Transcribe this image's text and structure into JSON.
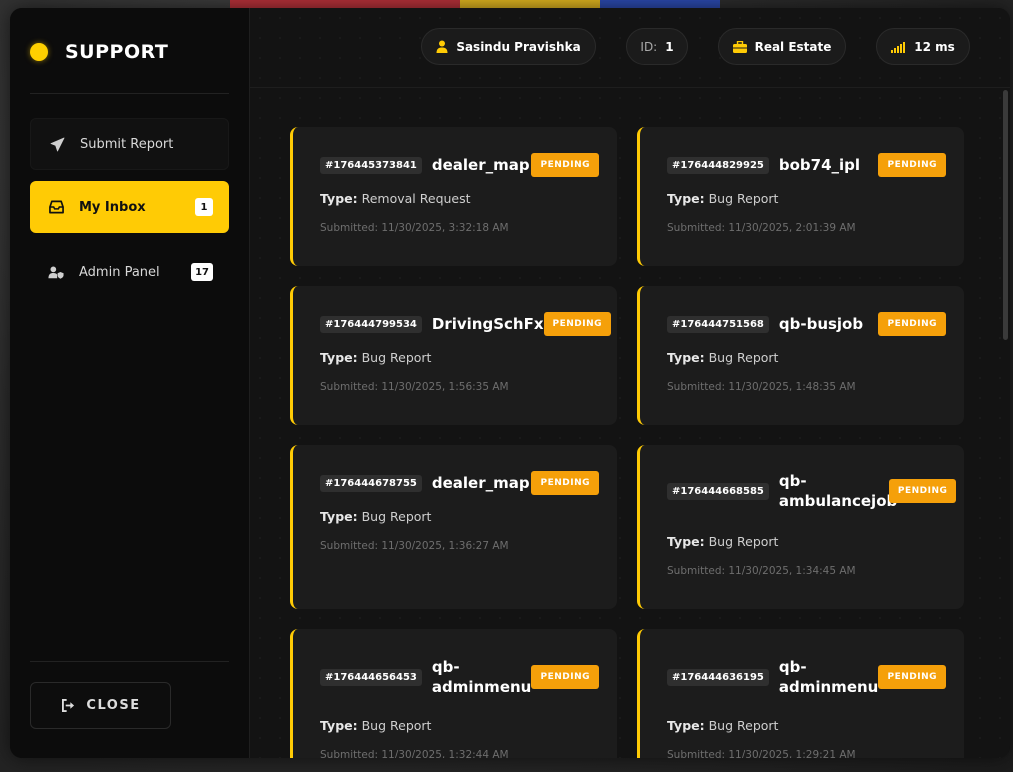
{
  "brand": {
    "title": "SUPPORT"
  },
  "nav": {
    "items": [
      {
        "label": "Submit Report",
        "icon": "paper-plane-icon",
        "badge": null,
        "state": "default"
      },
      {
        "label": "My Inbox",
        "icon": "inbox-icon",
        "badge": "1",
        "state": "active"
      },
      {
        "label": "Admin Panel",
        "icon": "user-shield-icon",
        "badge": "17",
        "state": "default"
      }
    ],
    "close_label": "CLOSE"
  },
  "header": {
    "user_name": "Sasindu Pravishka",
    "id_label": "ID:",
    "id_value": "1",
    "job": "Real Estate",
    "ping": "12 ms"
  },
  "colors": {
    "accent": "#ffcb05",
    "status_pending": "#f5a00a"
  },
  "type_label": "Type:",
  "reports": [
    {
      "id": "#176445373841",
      "name": "dealer_map",
      "status": "PENDING",
      "type": "Removal Request",
      "submitted": "Submitted: 11/30/2025, 3:32:18 AM"
    },
    {
      "id": "#176444829925",
      "name": "bob74_ipl",
      "status": "PENDING",
      "type": "Bug Report",
      "submitted": "Submitted: 11/30/2025, 2:01:39 AM"
    },
    {
      "id": "#176444799534",
      "name": "DrivingSchFx",
      "status": "PENDING",
      "type": "Bug Report",
      "submitted": "Submitted: 11/30/2025, 1:56:35 AM"
    },
    {
      "id": "#176444751568",
      "name": "qb-busjob",
      "status": "PENDING",
      "type": "Bug Report",
      "submitted": "Submitted: 11/30/2025, 1:48:35 AM"
    },
    {
      "id": "#176444678755",
      "name": "dealer_map",
      "status": "PENDING",
      "type": "Bug Report",
      "submitted": "Submitted: 11/30/2025, 1:36:27 AM"
    },
    {
      "id": "#176444668585",
      "name": "qb-ambulancejob",
      "status": "PENDING",
      "type": "Bug Report",
      "submitted": "Submitted: 11/30/2025, 1:34:45 AM"
    },
    {
      "id": "#176444656453",
      "name": "qb-adminmenu",
      "status": "PENDING",
      "type": "Bug Report",
      "submitted": "Submitted: 11/30/2025, 1:32:44 AM"
    },
    {
      "id": "#176444636195",
      "name": "qb-adminmenu",
      "status": "PENDING",
      "type": "Bug Report",
      "submitted": "Submitted: 11/30/2025, 1:29:21 AM"
    }
  ]
}
